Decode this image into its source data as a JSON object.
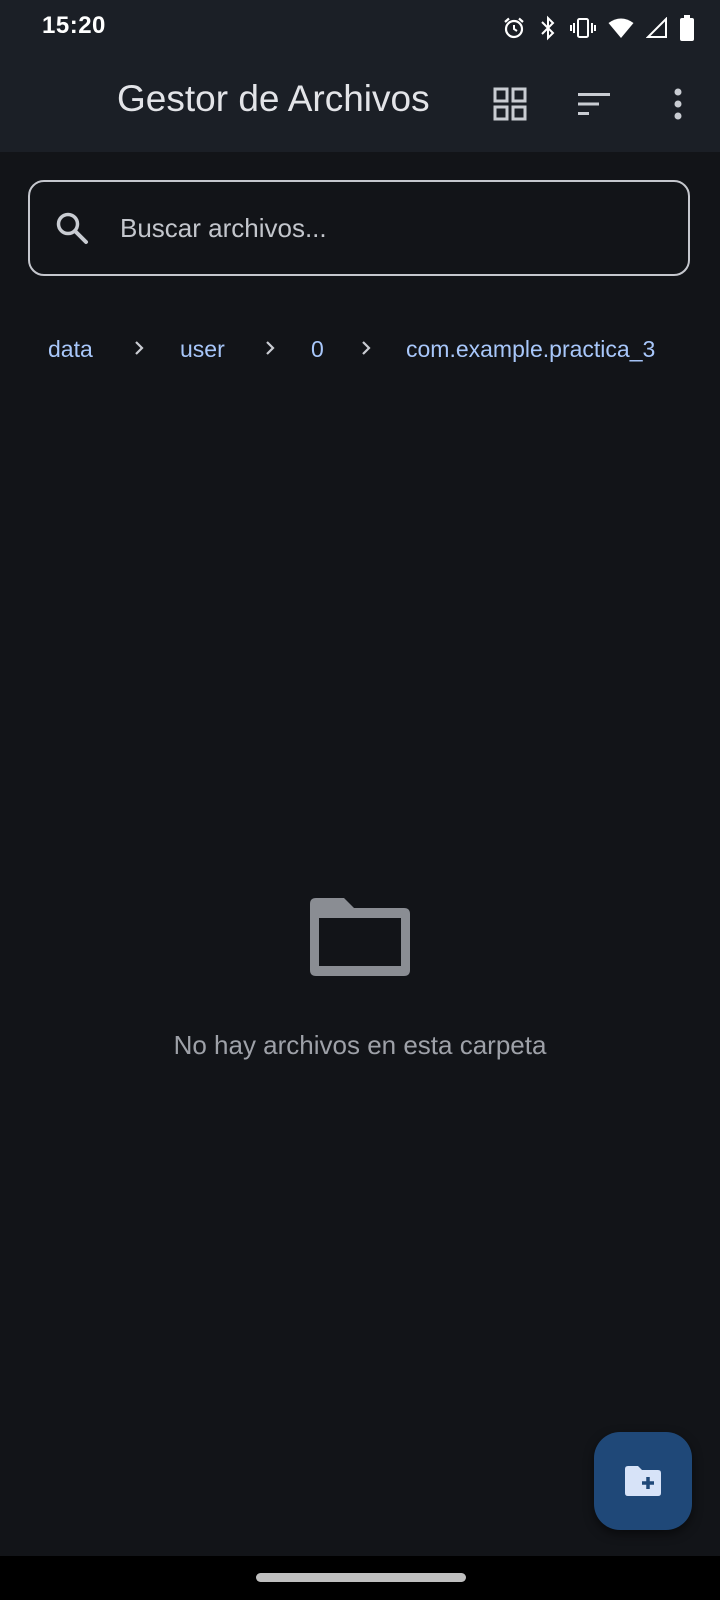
{
  "status_bar": {
    "time": "15:20",
    "icons": [
      "alarm-icon",
      "bluetooth-icon",
      "vibrate-icon",
      "wifi-icon",
      "signal-icon",
      "battery-icon"
    ]
  },
  "app_bar": {
    "title": "Gestor de Archivos",
    "actions": [
      "grid-view-icon",
      "sort-icon",
      "more-options-icon"
    ]
  },
  "search": {
    "placeholder": "Buscar archivos...",
    "value": ""
  },
  "breadcrumb": {
    "items": [
      "data",
      "user",
      "0",
      "com.example.practica_3"
    ],
    "separator_icon": "chevron-right-icon"
  },
  "empty_state": {
    "icon": "folder-icon",
    "message": "No hay archivos en esta carpeta"
  },
  "fab": {
    "icon": "create-folder-icon"
  },
  "colors": {
    "background": "#121418",
    "app_bar": "#1b1f26",
    "accent": "#a8c7fa",
    "fab": "#1f4878",
    "muted_text": "#9ea1a8"
  }
}
